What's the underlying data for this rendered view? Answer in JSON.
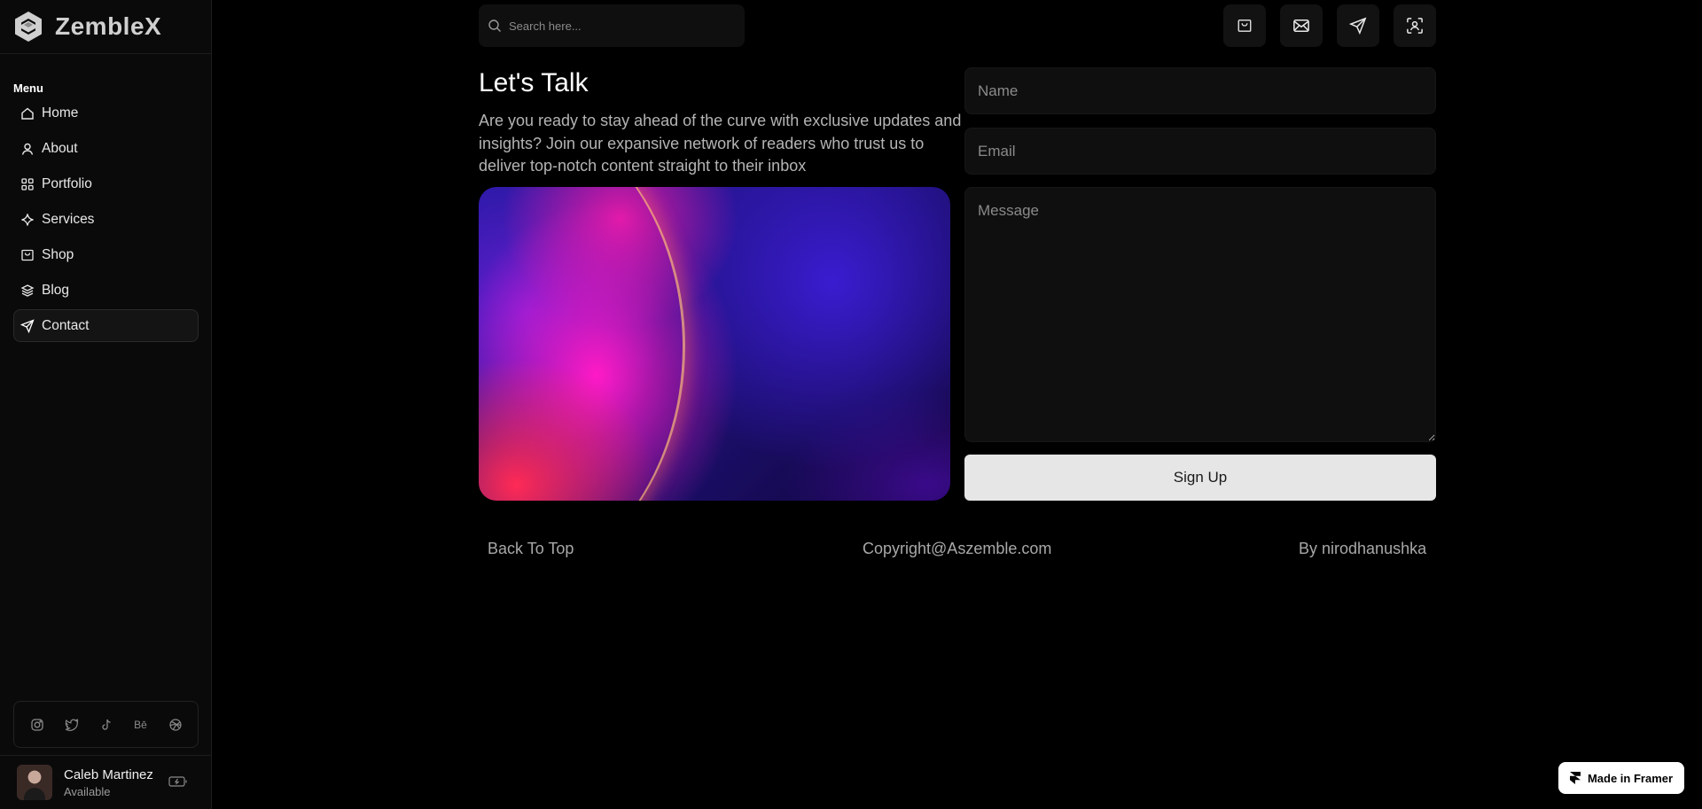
{
  "brand": {
    "name": "ZembleX"
  },
  "sidebar": {
    "menu_heading": "Menu",
    "items": [
      {
        "label": "Home",
        "icon": "home-icon"
      },
      {
        "label": "About",
        "icon": "user-icon"
      },
      {
        "label": "Portfolio",
        "icon": "grid-icon"
      },
      {
        "label": "Services",
        "icon": "sparkle-icon"
      },
      {
        "label": "Shop",
        "icon": "shop-icon"
      },
      {
        "label": "Blog",
        "icon": "layers-icon"
      },
      {
        "label": "Contact",
        "icon": "send-icon",
        "active": true
      }
    ],
    "socials": [
      {
        "name": "instagram-icon"
      },
      {
        "name": "twitter-icon"
      },
      {
        "name": "tiktok-icon"
      },
      {
        "name": "behance-icon",
        "text": "Bē"
      },
      {
        "name": "dribbble-icon"
      }
    ],
    "profile": {
      "name": "Caleb Martinez",
      "status": "Available"
    }
  },
  "search": {
    "placeholder": "Search here..."
  },
  "top_icons": [
    "shop-icon",
    "mail-icon",
    "send-icon",
    "profile-scan-icon"
  ],
  "contact": {
    "title": "Let's Talk",
    "description": "Are you ready to stay ahead of the curve with exclusive updates and insights? Join our expansive network of readers who trust us to deliver top-notch content straight to their inbox",
    "form": {
      "name_placeholder": "Name",
      "email_placeholder": "Email",
      "message_placeholder": "Message",
      "submit_label": "Sign Up"
    }
  },
  "footer": {
    "back_to_top": "Back To Top",
    "copyright": "Copyright@Aszemble.com",
    "by": "By nirodhanushka"
  },
  "badge": {
    "label": "Made in Framer"
  },
  "colors": {
    "background": "#000000",
    "sidebar": "#0a0a0a",
    "button": "#e6e6e6"
  }
}
